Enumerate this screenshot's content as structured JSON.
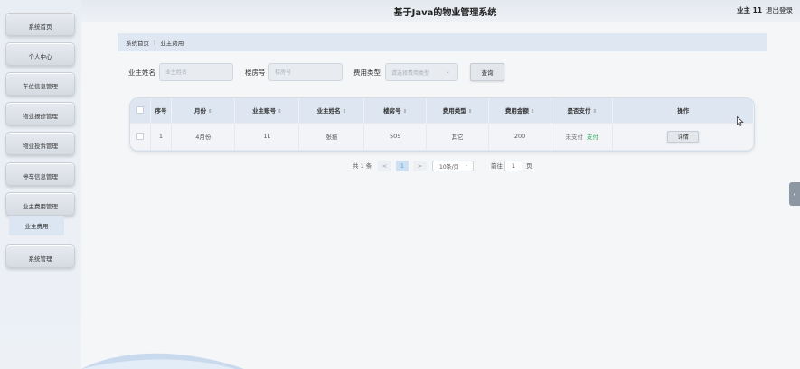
{
  "header": {
    "title": "基于Java的物业管理系统",
    "user_label": "业主 11",
    "logout_label": "退出登录"
  },
  "sidebar": {
    "items": [
      {
        "label": "系统首页"
      },
      {
        "label": "个人中心"
      },
      {
        "label": "车位信息管理"
      },
      {
        "label": "物业报修管理"
      },
      {
        "label": "物业投诉管理"
      },
      {
        "label": "停车信息管理"
      },
      {
        "label": "业主费用管理"
      },
      {
        "label": "系统管理"
      }
    ],
    "subitem": "业主费用"
  },
  "breadcrumb": {
    "home": "系统首页",
    "separator": "|",
    "current": "业主费用"
  },
  "search": {
    "owner_name_label": "业主姓名",
    "owner_name_placeholder": "业主姓名",
    "building_label": "楼房号",
    "building_placeholder": "楼房号",
    "fee_type_label": "费用类型",
    "fee_type_placeholder": "请选择费用类型",
    "query_label": "查询"
  },
  "table": {
    "headers": {
      "index": "序号",
      "month": "月份",
      "account": "业主账号",
      "name": "业主姓名",
      "building": "楼房号",
      "fee_type": "费用类型",
      "amount": "费用金额",
      "paid": "是否支付",
      "action": "操作"
    },
    "rows": [
      {
        "index": "1",
        "month": "4月份",
        "account": "11",
        "name": "张振",
        "building": "505",
        "fee_type": "其它",
        "amount": "200",
        "paid_status": "未支付",
        "pay_link": "支付",
        "detail_label": "详情"
      }
    ]
  },
  "pagination": {
    "total": "共 1 条",
    "prev": "<",
    "current": "1",
    "next": ">",
    "page_size": "10条/页",
    "goto_label": "前往",
    "goto_value": "1",
    "page_unit": "页"
  },
  "icons": {
    "sort": "sort-caret-icon",
    "chevron": "chevron-down-icon",
    "edge_tab": "chevron-left-icon",
    "cursor": "mouse-pointer-icon"
  },
  "colors": {
    "accent": "#409eff",
    "pay_link": "#2fae5c",
    "active_page_bg": "#cfe0f1"
  }
}
